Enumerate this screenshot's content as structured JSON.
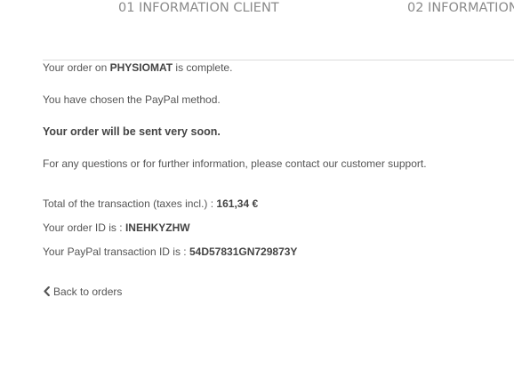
{
  "steps": [
    {
      "label": "01 INFORMATION CLIENT"
    },
    {
      "label": "02 INFORMATION"
    }
  ],
  "confirmation": {
    "order_prefix": "Your order on ",
    "shop_name": "PHYSIOMAT",
    "order_suffix": " is complete.",
    "method_text": "You have chosen the PayPal method.",
    "shipping_text": "Your order will be sent very soon.",
    "support_text": "For any questions or for further information, please contact our customer support.",
    "total_label": "Total of the transaction (taxes incl.) : ",
    "total_value": "161,34 €",
    "order_id_label": "Your order ID is : ",
    "order_id_value": "INEHKYZHW",
    "paypal_id_label": "Your PayPal transaction ID is : ",
    "paypal_id_value": "54D57831GN729873Y"
  },
  "navigation": {
    "back_label": "Back to orders",
    "back_icon": "chevron-left-icon"
  }
}
